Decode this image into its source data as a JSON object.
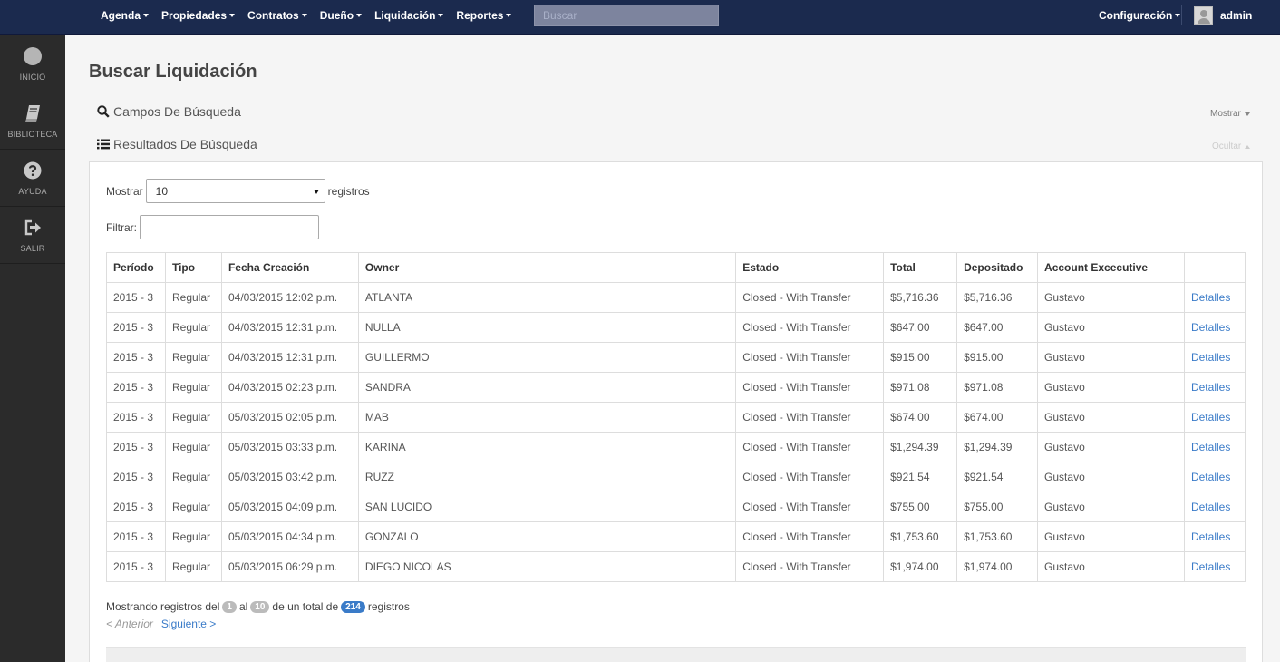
{
  "nav": {
    "items": [
      "Agenda",
      "Propiedades",
      "Contratos",
      "Dueño",
      "Liquidación",
      "Reportes"
    ],
    "search_placeholder": "Buscar",
    "config_label": "Configuración",
    "user_name": "admin"
  },
  "sidebar": {
    "items": [
      {
        "label": "INICIO",
        "icon": "home-circle-icon"
      },
      {
        "label": "BIBLIOTECA",
        "icon": "book-icon"
      },
      {
        "label": "AYUDA",
        "icon": "question-icon"
      },
      {
        "label": "SALIR",
        "icon": "sign-out-icon"
      }
    ]
  },
  "page": {
    "title": "Buscar Liquidación",
    "search_fields_label": "Campos De Búsqueda",
    "show_toggle": "Mostrar",
    "results_label": "Resultados De Búsqueda",
    "hide_toggle": "Ocultar"
  },
  "controls": {
    "show_label": "Mostrar",
    "page_size": "10",
    "records_label": "registros",
    "filter_label": "Filtrar:"
  },
  "table": {
    "headers": [
      "Período",
      "Tipo",
      "Fecha Creación",
      "Owner",
      "Estado",
      "Total",
      "Depositado",
      "Account Excecutive",
      ""
    ],
    "link_label": "Detalles",
    "rows": [
      [
        "2015 - 3",
        "Regular",
        "04/03/2015 12:02 p.m.",
        "ATLANTA",
        "Closed - With Transfer",
        "$5,716.36",
        "$5,716.36",
        "Gustavo"
      ],
      [
        "2015 - 3",
        "Regular",
        "04/03/2015 12:31 p.m.",
        "NULLA",
        "Closed - With Transfer",
        "$647.00",
        "$647.00",
        "Gustavo"
      ],
      [
        "2015 - 3",
        "Regular",
        "04/03/2015 12:31 p.m.",
        "GUILLERMO",
        "Closed - With Transfer",
        "$915.00",
        "$915.00",
        "Gustavo"
      ],
      [
        "2015 - 3",
        "Regular",
        "04/03/2015 02:23 p.m.",
        "SANDRA",
        "Closed - With Transfer",
        "$971.08",
        "$971.08",
        "Gustavo"
      ],
      [
        "2015 - 3",
        "Regular",
        "05/03/2015 02:05 p.m.",
        "MAB",
        "Closed - With Transfer",
        "$674.00",
        "$674.00",
        "Gustavo"
      ],
      [
        "2015 - 3",
        "Regular",
        "05/03/2015 03:33 p.m.",
        "KARINA",
        "Closed - With Transfer",
        "$1,294.39",
        "$1,294.39",
        "Gustavo"
      ],
      [
        "2015 - 3",
        "Regular",
        "05/03/2015 03:42 p.m.",
        "RUZZ",
        "Closed - With Transfer",
        "$921.54",
        "$921.54",
        "Gustavo"
      ],
      [
        "2015 - 3",
        "Regular",
        "05/03/2015 04:09 p.m.",
        "SAN LUCIDO",
        "Closed - With Transfer",
        "$755.00",
        "$755.00",
        "Gustavo"
      ],
      [
        "2015 - 3",
        "Regular",
        "05/03/2015 04:34 p.m.",
        "GONZALO",
        "Closed - With Transfer",
        "$1,753.60",
        "$1,753.60",
        "Gustavo"
      ],
      [
        "2015 - 3",
        "Regular",
        "05/03/2015 06:29 p.m.",
        "DIEGO NICOLAS",
        "Closed - With Transfer",
        "$1,974.00",
        "$1,974.00",
        "Gustavo"
      ]
    ]
  },
  "footer": {
    "info_prefix": "Mostrando registros del",
    "from": "1",
    "al": "al",
    "to": "10",
    "total_prefix": "de un total de",
    "total": "214",
    "info_suffix": "registros",
    "prev": "< Anterior",
    "next": "Siguiente >"
  }
}
